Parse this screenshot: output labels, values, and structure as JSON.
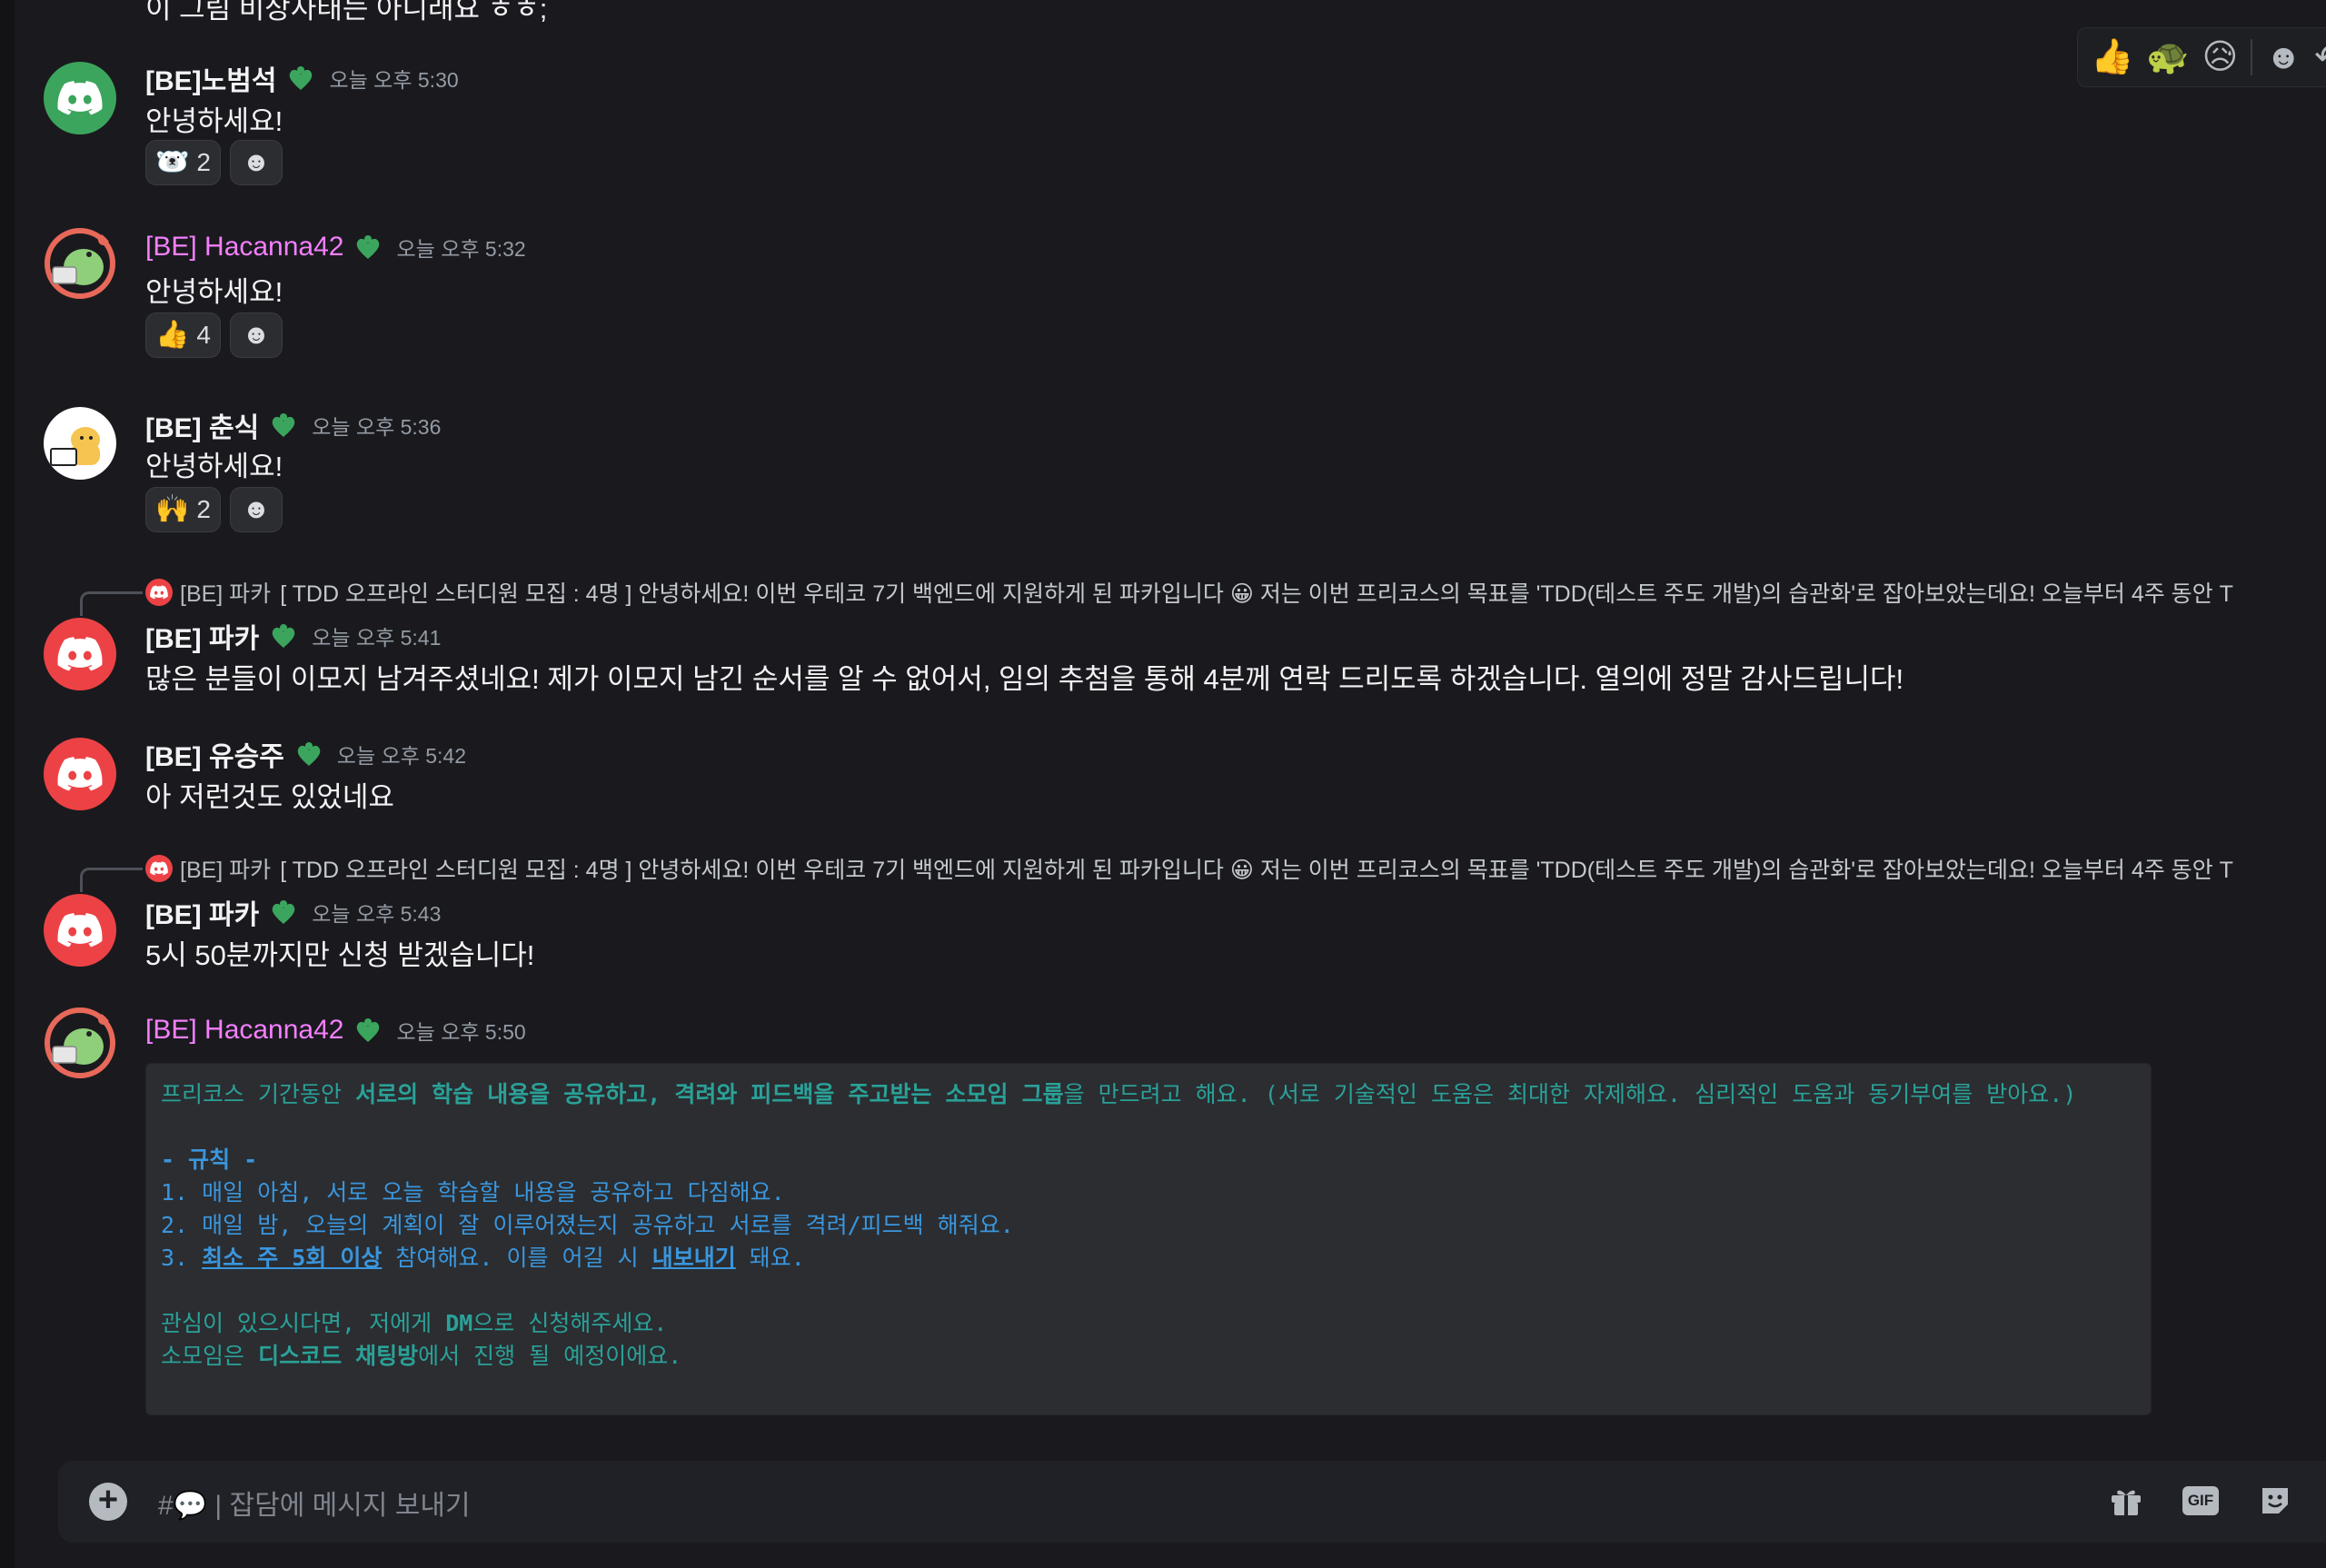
{
  "top_cut_text": "이 그림 비상사태는 아니래요 ㅎㅎ;",
  "hover_bar": {
    "buttons": [
      "👍",
      "🐢",
      "😥",
      "☻",
      "↶"
    ]
  },
  "messages": [
    {
      "username": "[BE]노범석",
      "timestamp": "오늘 오후 5:30",
      "text": "안녕하세요!",
      "reaction": {
        "emoji": "🐻‍❄️",
        "count": "2"
      }
    },
    {
      "username": "[BE] Hacanna42",
      "timestamp": "오늘 오후 5:32",
      "text": "안녕하세요!",
      "reaction": {
        "emoji": "👍",
        "count": "4"
      }
    },
    {
      "username": "[BE] 춘식",
      "timestamp": "오늘 오후 5:36",
      "text": "안녕하세요!",
      "reaction": {
        "emoji": "🙌",
        "count": "2"
      }
    },
    {
      "reply": {
        "name": "[BE] 파카",
        "text": "[ TDD 오프라인 스터디원 모집 : 4명 ]  안녕하세요! 이번 우테코 7기 백엔드에 지원하게 된 파카입니다 😀  저는 이번 프리코스의 목표를 'TDD(테스트 주도 개발)의 습관화'로 잡아보았는데요! 오늘부터 4주 동안 T"
      },
      "username": "[BE] 파카",
      "timestamp": "오늘 오후 5:41",
      "text": "많은 분들이 이모지 남겨주셨네요! 제가 이모지 남긴 순서를 알 수 없어서, 임의 추첨을 통해 4분께 연락 드리도록 하겠습니다. 열의에 정말 감사드립니다!"
    },
    {
      "username": "[BE] 유승주",
      "timestamp": "오늘 오후 5:42",
      "text": "아 저런것도 있었네요"
    },
    {
      "reply": {
        "name": "[BE] 파카",
        "text": "[ TDD 오프라인 스터디원 모집 : 4명 ]  안녕하세요! 이번 우테코 7기 백엔드에 지원하게 된 파카입니다 😀  저는 이번 프리코스의 목표를 'TDD(테스트 주도 개발)의 습관화'로 잡아보았는데요! 오늘부터 4주 동안 T"
      },
      "username": "[BE] 파카",
      "timestamp": "오늘 오후 5:43",
      "text": "5시 50분까지만 신청 받겠습니다!"
    },
    {
      "username": "[BE] Hacanna42",
      "timestamp": "오늘 오후 5:50",
      "code": {
        "l1_a": "프리코스 기간동안 ",
        "l1_b": "서로의 학습 내용을 공유하고, 격려와 피드백을 주고받는 소모임 그룹",
        "l1_c": "을 만드려고 해요. (서로 기술적인 도움은 최대한 자제해요. 심리적인 도움과 동기부여를 받아요.)",
        "rules_title": "- 규칙 -",
        "rule1": "1. 매일 아침, 서로 오늘 학습할 내용을 공유하고 다짐해요.",
        "rule2": "2. 매일 밤, 오늘의 계획이 잘 이루어졌는지 공유하고 서로를 격려/피드백 해줘요.",
        "rule3_a": "3. ",
        "rule3_b": "최소 주 5회 이상",
        "rule3_c": " 참여해요. 이를 어길 시 ",
        "rule3_d": "내보내기",
        "rule3_e": " 돼요.",
        "l5_a": "관심이 있으시다면, 저에게 ",
        "l5_b": "DM",
        "l5_c": "으로 신청해주세요.",
        "l6_a": "소모임은 ",
        "l6_b": "디스코드 채팅방",
        "l6_c": "에서 진행 될 예정이에요."
      }
    }
  ],
  "composer": {
    "channel_prefix": "#💬 | ",
    "placeholder": "잡담에 메시지 보내기"
  },
  "colors": {
    "background": "#1a1a1e",
    "pink_name": "#f47fff",
    "role_icon": "#3ba55d",
    "code_text": "#2aa198",
    "code_blue": "#3a96dd"
  }
}
